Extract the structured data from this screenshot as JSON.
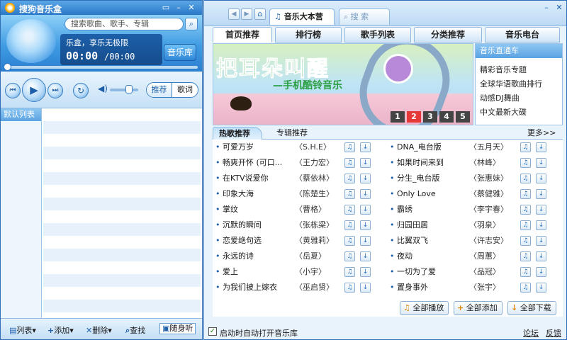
{
  "player": {
    "title": "搜狗音乐盒",
    "search_placeholder": "搜索歌曲、歌手、专辑",
    "lcd_message": "乐盒，享乐无极限",
    "time_current": "00:00",
    "time_total": "/00:00",
    "library_button": "音乐库",
    "tab_recommend": "推荐",
    "tab_lyrics": "歌词",
    "default_list": "默认列表",
    "footer": {
      "list": "列表",
      "add": "添加",
      "delete": "删除",
      "find": "查找",
      "follow": "随身听"
    }
  },
  "music": {
    "browser_tab_active": "音乐大本营",
    "browser_tab_search": "搜 索",
    "tabs": [
      "首页推荐",
      "排行榜",
      "歌手列表",
      "分类推荐",
      "音乐电台"
    ],
    "banner": {
      "headline": "把耳朵叫醒",
      "subline": "—手机酷铃音乐",
      "pages": [
        "1",
        "2",
        "3",
        "4",
        "5"
      ],
      "active_page": 2
    },
    "radio": {
      "title": "音乐直通车",
      "items": [
        "精彩音乐专题",
        "全球华语歌曲排行",
        "动感DJ舞曲",
        "中文最新大碟"
      ]
    },
    "subtabs": {
      "hot": "热歌推荐",
      "album": "专辑推荐",
      "more": "更多>>"
    },
    "songs_left": [
      {
        "title": "可爱万岁",
        "singer": "〈S.H.E〉"
      },
      {
        "title": "畅爽开怀 (可口...",
        "singer": "〈王力宏〉"
      },
      {
        "title": "在KTV说爱你",
        "singer": "〈蔡依林〉"
      },
      {
        "title": "印象大海",
        "singer": "〈陈楚生〉"
      },
      {
        "title": "掌纹",
        "singer": "〈曹格〉"
      },
      {
        "title": "沉默的瞬间",
        "singer": "〈张栋梁〉"
      },
      {
        "title": "恋爱绝句选",
        "singer": "〈黄雅莉〉"
      },
      {
        "title": "永远的诗",
        "singer": "〈岳夏〉"
      },
      {
        "title": "爱上",
        "singer": "〈小宇〉"
      },
      {
        "title": "为我们披上嫁衣",
        "singer": "〈巫启贤〉"
      }
    ],
    "songs_right": [
      {
        "title": "DNA_电台版",
        "singer": "〈五月天〉"
      },
      {
        "title": "如果时间来到",
        "singer": "〈林峰〉"
      },
      {
        "title": "分生_电台版",
        "singer": "〈张惠妹〉"
      },
      {
        "title": "Only Love",
        "singer": "〈蔡健雅〉"
      },
      {
        "title": "霸绣",
        "singer": "〈李宇春〉"
      },
      {
        "title": "归园田居",
        "singer": "〈羽泉〉"
      },
      {
        "title": "比翼双飞",
        "singer": "〈许志安〉"
      },
      {
        "title": "夜动",
        "singer": "〈周蕙〉"
      },
      {
        "title": "一切为了爱",
        "singer": "〈品冠〉"
      },
      {
        "title": "置身事外",
        "singer": "〈张宇〉"
      }
    ],
    "actions": {
      "play_all": "全部播放",
      "add_all": "全部添加",
      "download_all": "全部下载"
    },
    "footer": {
      "autostart": "启动时自动打开音乐库",
      "forum": "论坛",
      "feedback": "反馈"
    }
  }
}
